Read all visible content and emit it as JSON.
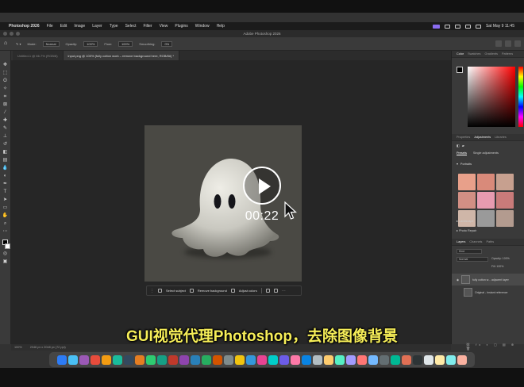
{
  "menubar": {
    "app_name": "Photoshop 2026",
    "items": [
      "File",
      "Edit",
      "Image",
      "Layer",
      "Type",
      "Select",
      "Filter",
      "View",
      "Plugins",
      "Window",
      "Help"
    ],
    "clock": "Sat May 9  11:45"
  },
  "titlebar": {
    "title": "Adobe Photoshop 2026"
  },
  "options": {
    "mode_label": "Mode:",
    "mode_value": "Normal",
    "opacity_label": "Opacity:",
    "opacity_value": "100%",
    "flow_label": "Flow:",
    "flow_value": "100%",
    "smoothing_label": "Smoothing:",
    "smoothing_value": "0%"
  },
  "tabs": [
    {
      "label": "Untitled-1 @ 66.7% (RGB/8)"
    },
    {
      "label": "input.png @ 100% (fully cotton work – remove background here, RGB/8#) *"
    }
  ],
  "video": {
    "timestamp": "00:22"
  },
  "context_bar": {
    "select_subject": "Select subject",
    "remove_background": "Remove background",
    "adjust_colors": "Adjust colors"
  },
  "panels": {
    "color_tabs": [
      "Color",
      "Swatches",
      "Gradients",
      "Patterns"
    ],
    "props_tabs": [
      "Properties",
      "Adjustments",
      "Libraries"
    ],
    "adj_subtabs": [
      "Presets",
      "Single adjustments"
    ],
    "adj_groups": [
      "Portraits",
      "Landscape",
      "Photo Repair"
    ],
    "layers_tabs": [
      "Layers",
      "Channels",
      "Paths"
    ],
    "kind_label": "Kind",
    "blend_mode": "Normal",
    "opacity": "Opacity: 100%",
    "fill": "Fill: 100%",
    "layers": [
      {
        "name": "fully cotton w... adjacent layer"
      },
      {
        "name": "Original - Instant reference"
      }
    ],
    "preset_colors": [
      "#e8a08a",
      "#d98a7a",
      "#c7a08f",
      "#d28f84",
      "#e79bb0",
      "#c97b7a",
      "#cfb6a8",
      "#9a9a9a",
      "#b39b8f"
    ]
  },
  "status": {
    "zoom": "100%",
    "doc": "2048 px x 2048 px (72 ppi)"
  },
  "dock_colors": [
    "#2d7cf6",
    "#4ac0f5",
    "#9b59b6",
    "#e74c3c",
    "#f39c12",
    "#1abc9c",
    "#34495e",
    "#e67e22",
    "#2ecc71",
    "#16a085",
    "#c0392b",
    "#8e44ad",
    "#2980b9",
    "#27ae60",
    "#d35400",
    "#7f8c8d",
    "#f1c40f",
    "#3498db",
    "#e84393",
    "#00cec9",
    "#6c5ce7",
    "#fd79a8",
    "#0984e3",
    "#b2bec3",
    "#fdcb6e",
    "#55efc4",
    "#a29bfe",
    "#ff7675",
    "#74b9ff",
    "#636e72",
    "#00b894",
    "#e17055",
    "#2d3436",
    "#dfe6e9",
    "#ffeaa7",
    "#81ecec",
    "#fab1a0"
  ],
  "subtitle": "GUI视觉代理Photoshop，去除图像背景"
}
